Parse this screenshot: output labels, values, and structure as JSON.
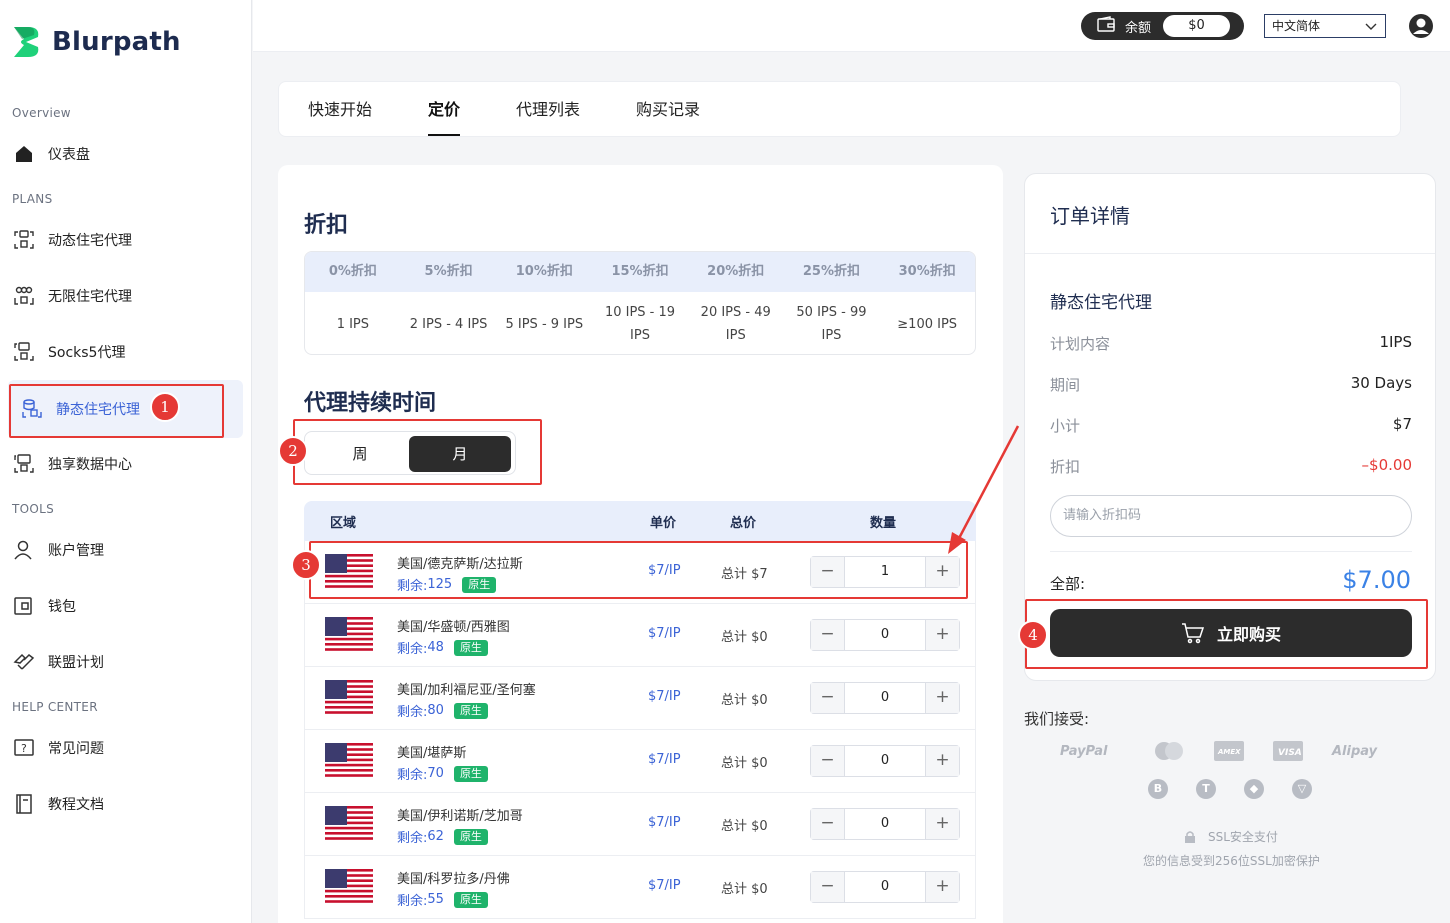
{
  "brand": {
    "name": "Blurpath",
    "accent": "#1fd17a"
  },
  "sidebar": {
    "sections": {
      "overview": "Overview",
      "plans": "PLANS",
      "tools": "TOOLS",
      "help": "HELP CENTER"
    },
    "items": [
      {
        "label": "仪表盘",
        "icon": "home-icon"
      },
      {
        "label": "动态住宅代理",
        "icon": "proxy-icon"
      },
      {
        "label": "无限住宅代理",
        "icon": "proxy-icon"
      },
      {
        "label": "Socks5代理",
        "icon": "proxy-icon"
      },
      {
        "label": "静态住宅代理",
        "icon": "proxy-icon",
        "active": true
      },
      {
        "label": "独享数据中心",
        "icon": "proxy-icon"
      },
      {
        "label": "账户管理",
        "icon": "user-icon"
      },
      {
        "label": "钱包",
        "icon": "wallet-icon"
      },
      {
        "label": "联盟计划",
        "icon": "affiliate-icon"
      },
      {
        "label": "常见问题",
        "icon": "faq-icon"
      },
      {
        "label": "教程文档",
        "icon": "doc-icon"
      }
    ]
  },
  "annotations": [
    "1",
    "2",
    "3",
    "4"
  ],
  "topbar": {
    "balance_label": "余额",
    "balance_value": "$0",
    "language": "中文简体"
  },
  "tabs": [
    "快速开始",
    "定价",
    "代理列表",
    "购买记录"
  ],
  "discount": {
    "title": "折扣",
    "headers": [
      "0%折扣",
      "5%折扣",
      "10%折扣",
      "15%折扣",
      "20%折扣",
      "25%折扣",
      "30%折扣"
    ],
    "ranges": [
      "1 IPS",
      "2 IPS - 4 IPS",
      "5 IPS - 9 IPS",
      "10 IPS - 19 IPS",
      "20 IPS - 49 IPS",
      "50 IPS - 99 IPS",
      "≥100 IPS"
    ]
  },
  "duration": {
    "title": "代理持续时间",
    "options": [
      "周",
      "月"
    ],
    "selected": "月"
  },
  "regions": {
    "headers": {
      "region": "区域",
      "unit_price": "单价",
      "total": "总价",
      "qty": "数量"
    },
    "stock_prefix": "剩余: ",
    "native_label": "原生",
    "rows": [
      {
        "name": "美国/德克萨斯/达拉斯",
        "stock": "125",
        "unit": "$7/IP",
        "total": "总计 $7",
        "qty": "1"
      },
      {
        "name": "美国/华盛顿/西雅图",
        "stock": "48",
        "unit": "$7/IP",
        "total": "总计 $0",
        "qty": "0"
      },
      {
        "name": "美国/加利福尼亚/圣何塞",
        "stock": "80",
        "unit": "$7/IP",
        "total": "总计 $0",
        "qty": "0"
      },
      {
        "name": "美国/堪萨斯",
        "stock": "70",
        "unit": "$7/IP",
        "total": "总计 $0",
        "qty": "0"
      },
      {
        "name": "美国/伊利诺斯/芝加哥",
        "stock": "62",
        "unit": "$7/IP",
        "total": "总计 $0",
        "qty": "0"
      },
      {
        "name": "美国/科罗拉多/丹佛",
        "stock": "55",
        "unit": "$7/IP",
        "total": "总计 $0",
        "qty": "0"
      }
    ]
  },
  "order": {
    "title": "订单详情",
    "product": "静态住宅代理",
    "rows": [
      {
        "k": "计划内容",
        "v": "1IPS"
      },
      {
        "k": "期间",
        "v": "30 Days"
      },
      {
        "k": "小计",
        "v": "$7"
      },
      {
        "k": "折扣",
        "v": "–$0.00"
      }
    ],
    "coupon_placeholder": "请输入折扣码",
    "total_label": "全部:",
    "total_value": "$7.00",
    "buy_label": "立即购买"
  },
  "payments": {
    "accept_label": "我们接受:",
    "methods": [
      "PayPal",
      "Mastercard",
      "AMEX",
      "VISA",
      "Alipay"
    ],
    "crypto": [
      "B",
      "T",
      "E",
      "TRX"
    ],
    "ssl_title": "SSL安全支付",
    "ssl_desc": "您的信息受到256位SSL加密保护"
  }
}
